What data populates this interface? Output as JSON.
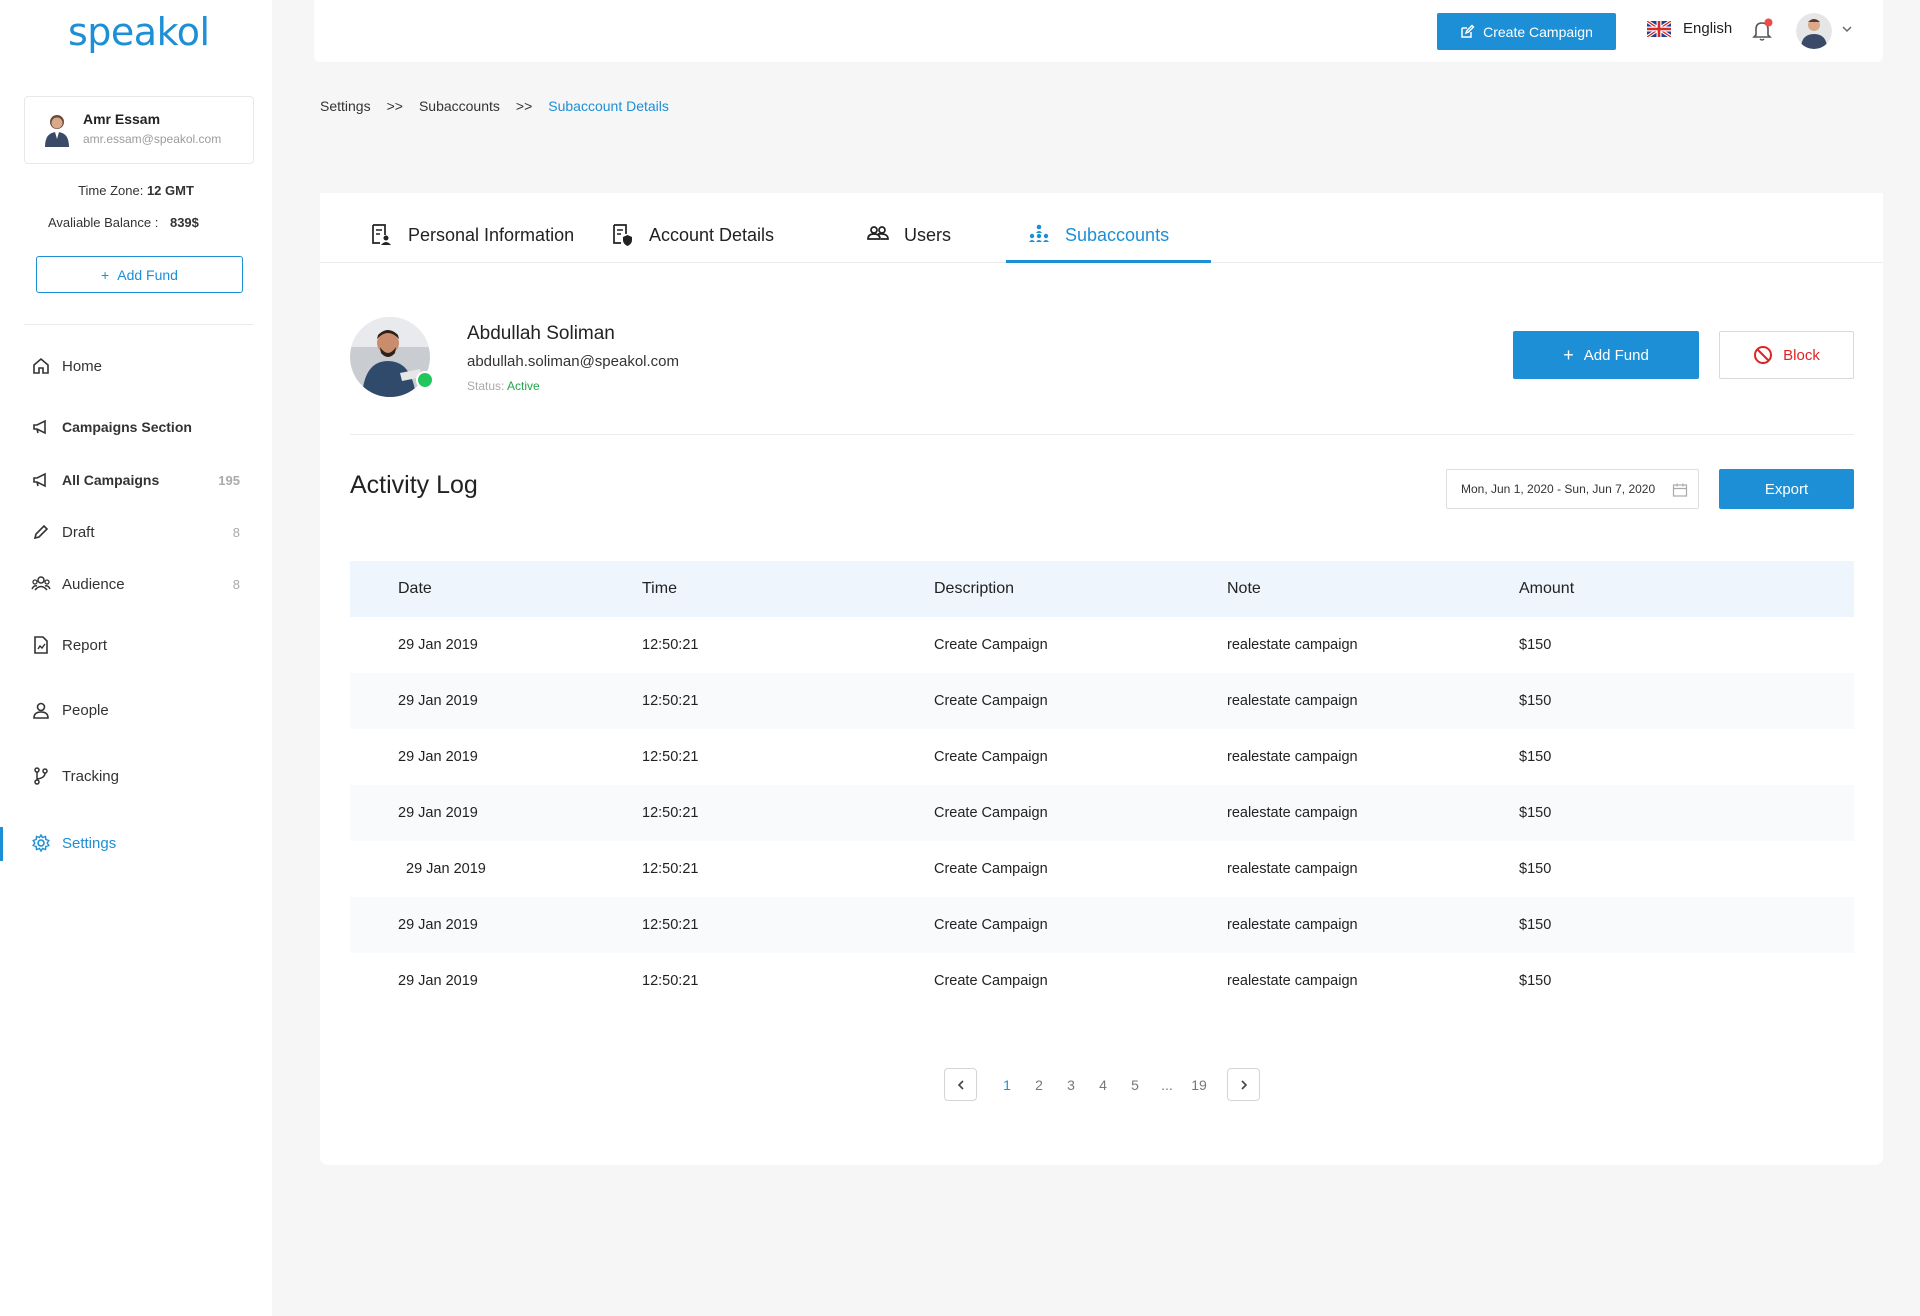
{
  "brand": {
    "logo": "speakol",
    "accent": "#1d8fd6"
  },
  "sidebar": {
    "user": {
      "name": "Amr Essam",
      "email": "amr.essam@speakol.com"
    },
    "timezone_label": "Time Zone:",
    "timezone_value": "12 GMT",
    "balance_label": "Avaliable Balance :",
    "balance_value": "839$",
    "add_fund": "Add Fund",
    "nav": [
      {
        "label": "Home",
        "icon": "home-icon"
      },
      {
        "label": "Campaigns Section",
        "icon": "megaphone-icon"
      },
      {
        "label": "All Campaigns",
        "icon": "megaphone-icon",
        "count": "195"
      },
      {
        "label": "Draft",
        "icon": "pencil-icon",
        "count": "8"
      },
      {
        "label": "Audience",
        "icon": "audience-icon",
        "count": "8"
      },
      {
        "label": "Report",
        "icon": "report-icon"
      },
      {
        "label": "People",
        "icon": "person-icon"
      },
      {
        "label": "Tracking",
        "icon": "branch-icon"
      },
      {
        "label": "Settings",
        "icon": "gear-icon"
      }
    ]
  },
  "topbar": {
    "create_campaign": "Create Campaign",
    "language": "English"
  },
  "breadcrumb": {
    "items": [
      "Settings",
      "Subaccounts"
    ],
    "separator": ">>",
    "current": "Subaccount Details"
  },
  "tabs": [
    {
      "label": "Personal Information",
      "icon": "profile-doc-icon"
    },
    {
      "label": "Account Details",
      "icon": "account-doc-icon"
    },
    {
      "label": "Users",
      "icon": "users-icon"
    },
    {
      "label": "Subaccounts",
      "icon": "hierarchy-icon",
      "active": true
    }
  ],
  "subaccount": {
    "name": "Abdullah Soliman",
    "email": "abdullah.soliman@speakol.com",
    "status_label": "Status:",
    "status_value": "Active",
    "add_fund": "Add Fund",
    "block": "Block"
  },
  "activity": {
    "title": "Activity Log",
    "date_range": "Mon, Jun 1, 2020 - Sun, Jun 7, 2020",
    "export": "Export",
    "columns": [
      "Date",
      "Time",
      "Description",
      "Note",
      "Amount"
    ],
    "rows": [
      [
        "29 Jan 2019",
        "12:50:21",
        "Create Campaign",
        "realestate campaign",
        "$150"
      ],
      [
        "29 Jan 2019",
        "12:50:21",
        "Create Campaign",
        "realestate campaign",
        "$150"
      ],
      [
        "29 Jan 2019",
        "12:50:21",
        "Create Campaign",
        "realestate campaign",
        "$150"
      ],
      [
        "29 Jan 2019",
        "12:50:21",
        "Create Campaign",
        "realestate campaign",
        "$150"
      ],
      [
        "29 Jan 2019",
        "12:50:21",
        "Create Campaign",
        "realestate campaign",
        "$150"
      ],
      [
        "29 Jan 2019",
        "12:50:21",
        "Create Campaign",
        "realestate campaign",
        "$150"
      ],
      [
        "29 Jan 2019",
        "12:50:21",
        "Create Campaign",
        "realestate campaign",
        "$150"
      ]
    ]
  },
  "pagination": {
    "pages": [
      "1",
      "2",
      "3",
      "4",
      "5",
      "...",
      "19"
    ],
    "current": "1"
  }
}
